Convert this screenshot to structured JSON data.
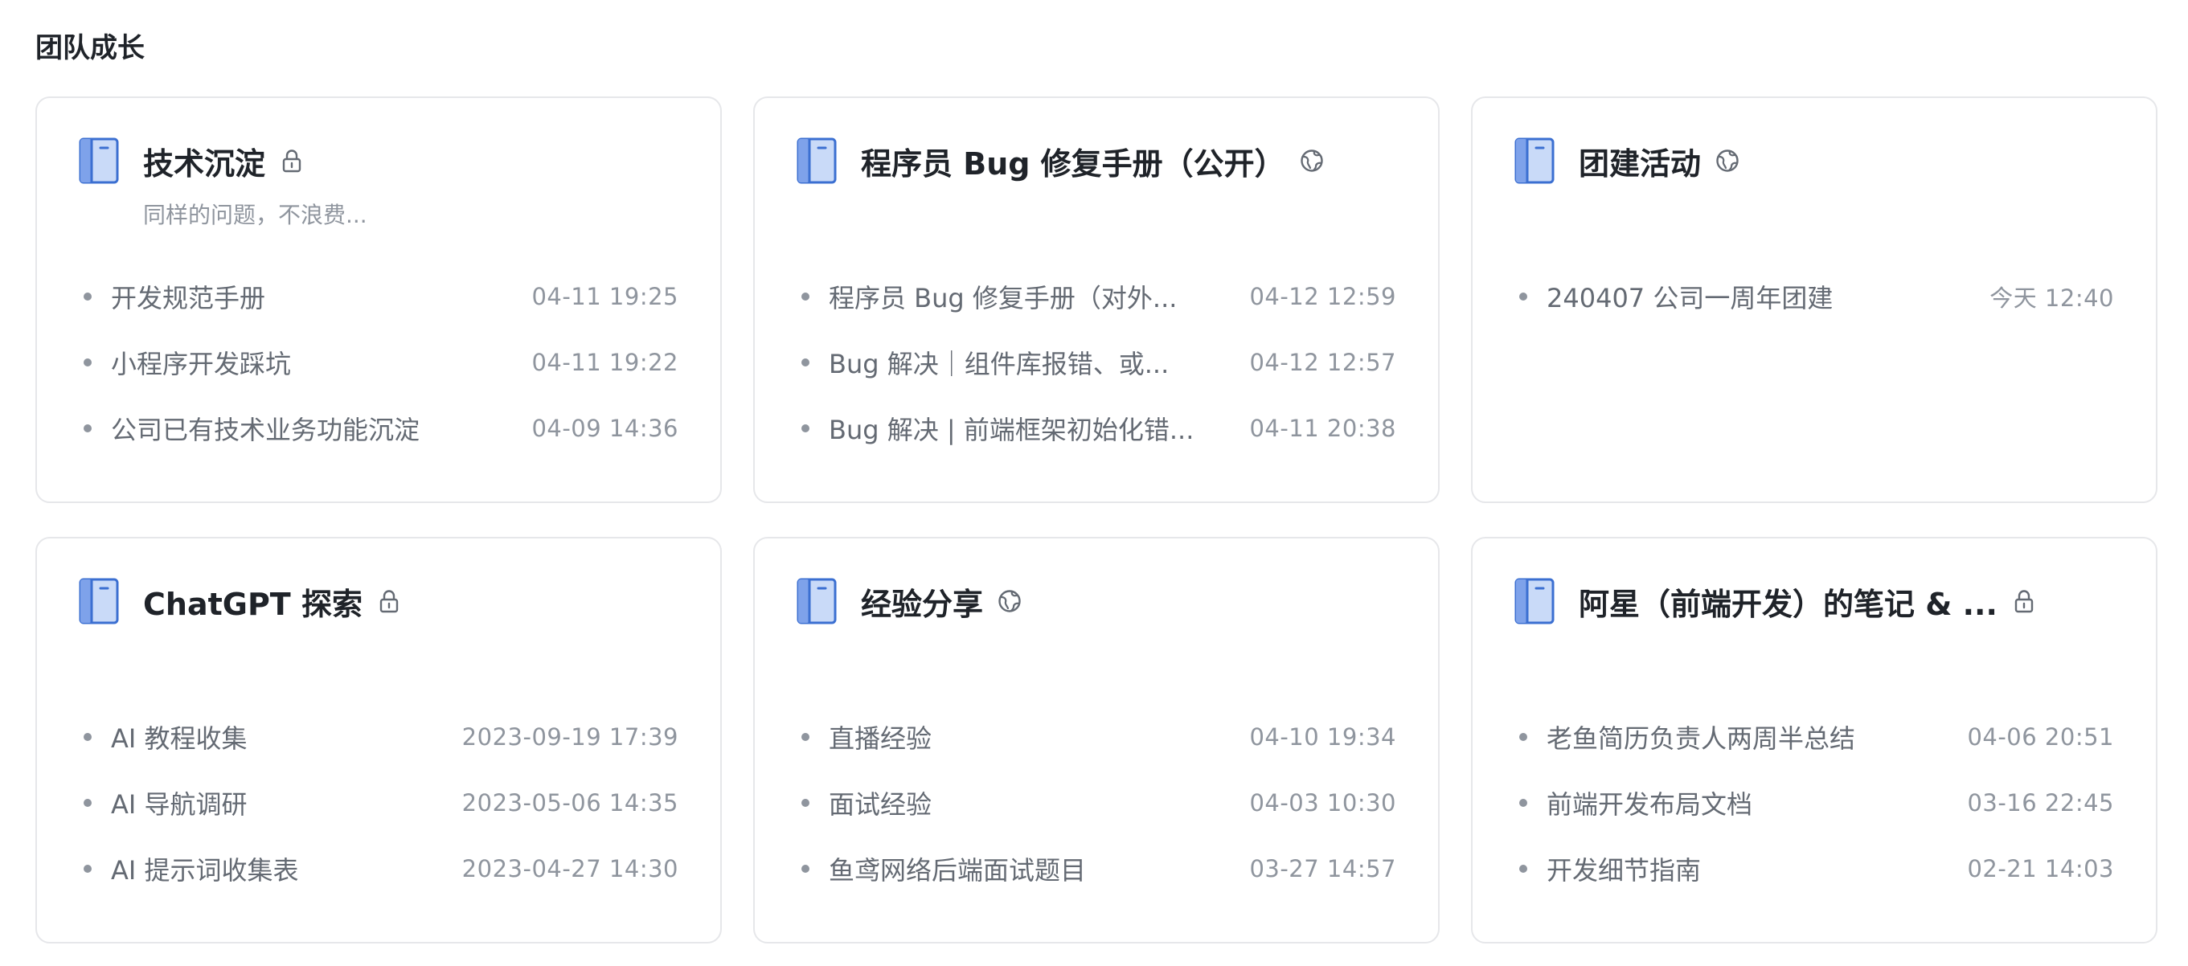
{
  "section": {
    "title": "团队成长"
  },
  "colors": {
    "icon_fill": "#c9daf8",
    "icon_stroke": "#3b6fd1",
    "icon_spine": "#7ea2ea",
    "border": "#e6e7ea",
    "meta_text": "#8f959e"
  },
  "cards": [
    {
      "title": "技术沉淀",
      "status_icon": "lock-icon",
      "description": "同样的问题，不浪费...",
      "items": [
        {
          "title": "开发规范手册",
          "time": "04-11 19:25"
        },
        {
          "title": "小程序开发踩坑",
          "time": "04-11 19:22"
        },
        {
          "title": "公司已有技术业务功能沉淀",
          "time": "04-09 14:36"
        }
      ]
    },
    {
      "title": "程序员 Bug 修复手册（公开）",
      "status_icon": "globe-icon",
      "description": "",
      "items": [
        {
          "title": "程序员 Bug 修复手册（对外...",
          "time": "04-12 12:59"
        },
        {
          "title": "Bug 解决｜组件库报错、或...",
          "time": "04-12 12:57"
        },
        {
          "title": "Bug 解决 | 前端框架初始化错...",
          "time": "04-11 20:38"
        }
      ]
    },
    {
      "title": "团建活动",
      "status_icon": "globe-icon",
      "description": "",
      "items": [
        {
          "title": "240407 公司一周年团建",
          "time": "今天 12:40"
        }
      ]
    },
    {
      "title": "ChatGPT 探索",
      "status_icon": "lock-icon",
      "description": "",
      "items": [
        {
          "title": "AI 教程收集",
          "time": "2023-09-19 17:39"
        },
        {
          "title": "AI 导航调研",
          "time": "2023-05-06 14:35"
        },
        {
          "title": "AI 提示词收集表",
          "time": "2023-04-27 14:30"
        }
      ]
    },
    {
      "title": "经验分享",
      "status_icon": "globe-icon",
      "description": "",
      "items": [
        {
          "title": "直播经验",
          "time": "04-10 19:34"
        },
        {
          "title": "面试经验",
          "time": "04-03 10:30"
        },
        {
          "title": "鱼鸢网络后端面试题目",
          "time": "03-27 14:57"
        }
      ]
    },
    {
      "title": "阿星（前端开发）的笔记 & ...",
      "status_icon": "lock-icon",
      "description": "",
      "items": [
        {
          "title": "老鱼简历负责人两周半总结",
          "time": "04-06 20:51"
        },
        {
          "title": "前端开发布局文档",
          "time": "03-16 22:45"
        },
        {
          "title": "开发细节指南",
          "time": "02-21 14:03"
        }
      ]
    }
  ]
}
